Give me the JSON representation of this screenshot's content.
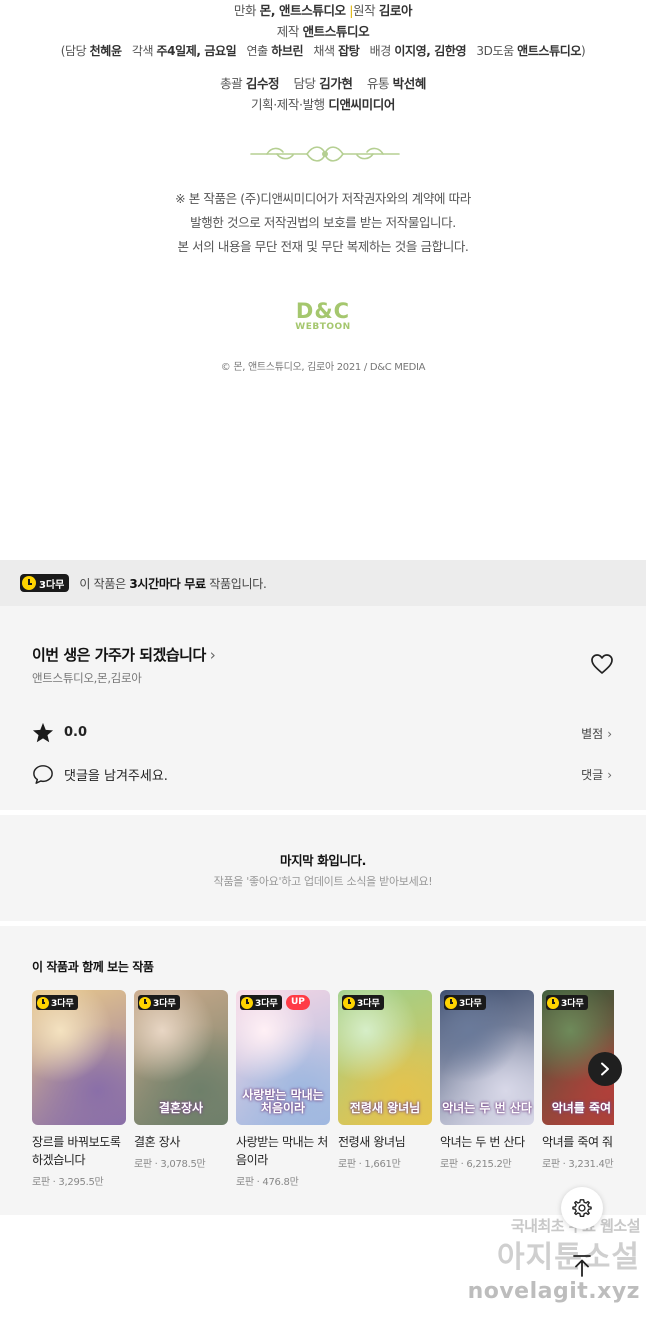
{
  "credits": {
    "line1": {
      "l1": "만화",
      "v1": "몬, 앤트스튜디오",
      "sep": "|",
      "l2": "원작",
      "v2": "김로아"
    },
    "line2": {
      "l1": "제작",
      "v1": "앤트스튜디오"
    },
    "line3": {
      "open": "(담당",
      "v1": "천혜윤",
      "l2": "각색",
      "v2": "주4일제, 금요일",
      "l3": "연출",
      "v3": "하브린",
      "l4": "채색",
      "v4": "잡탕",
      "l5": "배경",
      "v5": "이지영, 김한영",
      "l6": "3D도움",
      "v6": "앤트스튜디오",
      "close": ")"
    },
    "line4": {
      "l1": "총괄",
      "v1": "김수정",
      "l2": "담당",
      "v2": "김가현",
      "l3": "유통",
      "v3": "박선혜"
    },
    "line5": {
      "l1": "기획·제작·발행",
      "v1": "디앤씨미디어"
    },
    "notice": [
      "※ 본 작품은 (주)디앤씨미디어가 저작권자와의 계약에 따라",
      "발행한 것으로 저작권법의 보호를 받는 저작물입니다.",
      "본 서의 내용을 무단 전재 및 무단 복제하는 것을 금합니다."
    ],
    "logo": {
      "big": "D&C",
      "small": "WEBTOON"
    },
    "copyright": "© 몬, 앤트스튜디오, 김로아 2021 / D&C MEDIA"
  },
  "free_bar": {
    "badge": "3다무",
    "msg_pre": "이 작품은 ",
    "msg_bold": "3시간마다 무료",
    "msg_post": " 작품입니다."
  },
  "work": {
    "title": "이번 생은 가주가 되겠습니다",
    "chevron": "›",
    "authors": "앤트스튜디오,몬,김로아",
    "rating": "0.0",
    "rate_link": "별점",
    "comment_prompt": "댓글을 남겨주세요.",
    "comment_link": "댓글"
  },
  "last_episode": {
    "title": "마지막 화입니다.",
    "subtitle": "작품을 '좋아요'하고 업데이트 소식을 받아보세요!"
  },
  "recommend": {
    "heading": "이 작품과 함께 보는 작품",
    "items": [
      {
        "badge": "3다무",
        "up": "",
        "title": "장르를 바꿔보도록 하겠습니다",
        "meta": "로판 · 3,295.5만",
        "art": "",
        "c1": "#e9c98a",
        "c2": "#8a6fa8",
        "c3": "#f4e2c0"
      },
      {
        "badge": "3다무",
        "up": "",
        "title": "결혼 장사",
        "meta": "로판 · 3,078.5만",
        "art": "결혼장사",
        "c1": "#c9a98a",
        "c2": "#6e7f6a",
        "c3": "#e8d6c4"
      },
      {
        "badge": "3다무",
        "up": "UP",
        "title": "사랑받는 막내는 처음이라",
        "meta": "로판 · 476.8만",
        "art": "사랑받는 막내는 처음이라",
        "c1": "#f6d6e4",
        "c2": "#9fb8e0",
        "c3": "#fff0f5"
      },
      {
        "badge": "3다무",
        "up": "",
        "title": "전령새 왕녀님",
        "meta": "로판 · 1,661만",
        "art": "전령새 왕녀님",
        "c1": "#9fcf8a",
        "c2": "#e3c34f",
        "c3": "#d6eec8"
      },
      {
        "badge": "3다무",
        "up": "",
        "title": "악녀는 두 번 산다",
        "meta": "로판 · 6,215.2만",
        "art": "악녀는 두 번 산다",
        "c1": "#3a4a6a",
        "c2": "#d8d8e8",
        "c3": "#6a7a9a"
      },
      {
        "badge": "3다무",
        "up": "",
        "title": "악녀를 죽여 줘",
        "meta": "로판 · 3,231.4만",
        "art": "악녀를 죽여 줘",
        "c1": "#3d5a3a",
        "c2": "#b0403a",
        "c3": "#6e8a5a"
      }
    ]
  },
  "watermark": {
    "line1": "국내최초 무료 웹소설",
    "line2": "아지툰소설",
    "line3": "novelagit.xyz"
  },
  "colors": {
    "accent_yellow": "#ffd400",
    "badge_dark": "#1a1a1a",
    "up_red": "#ff3b46",
    "logo_green": "#a5c76e",
    "section_bg": "#f5f5f5"
  }
}
